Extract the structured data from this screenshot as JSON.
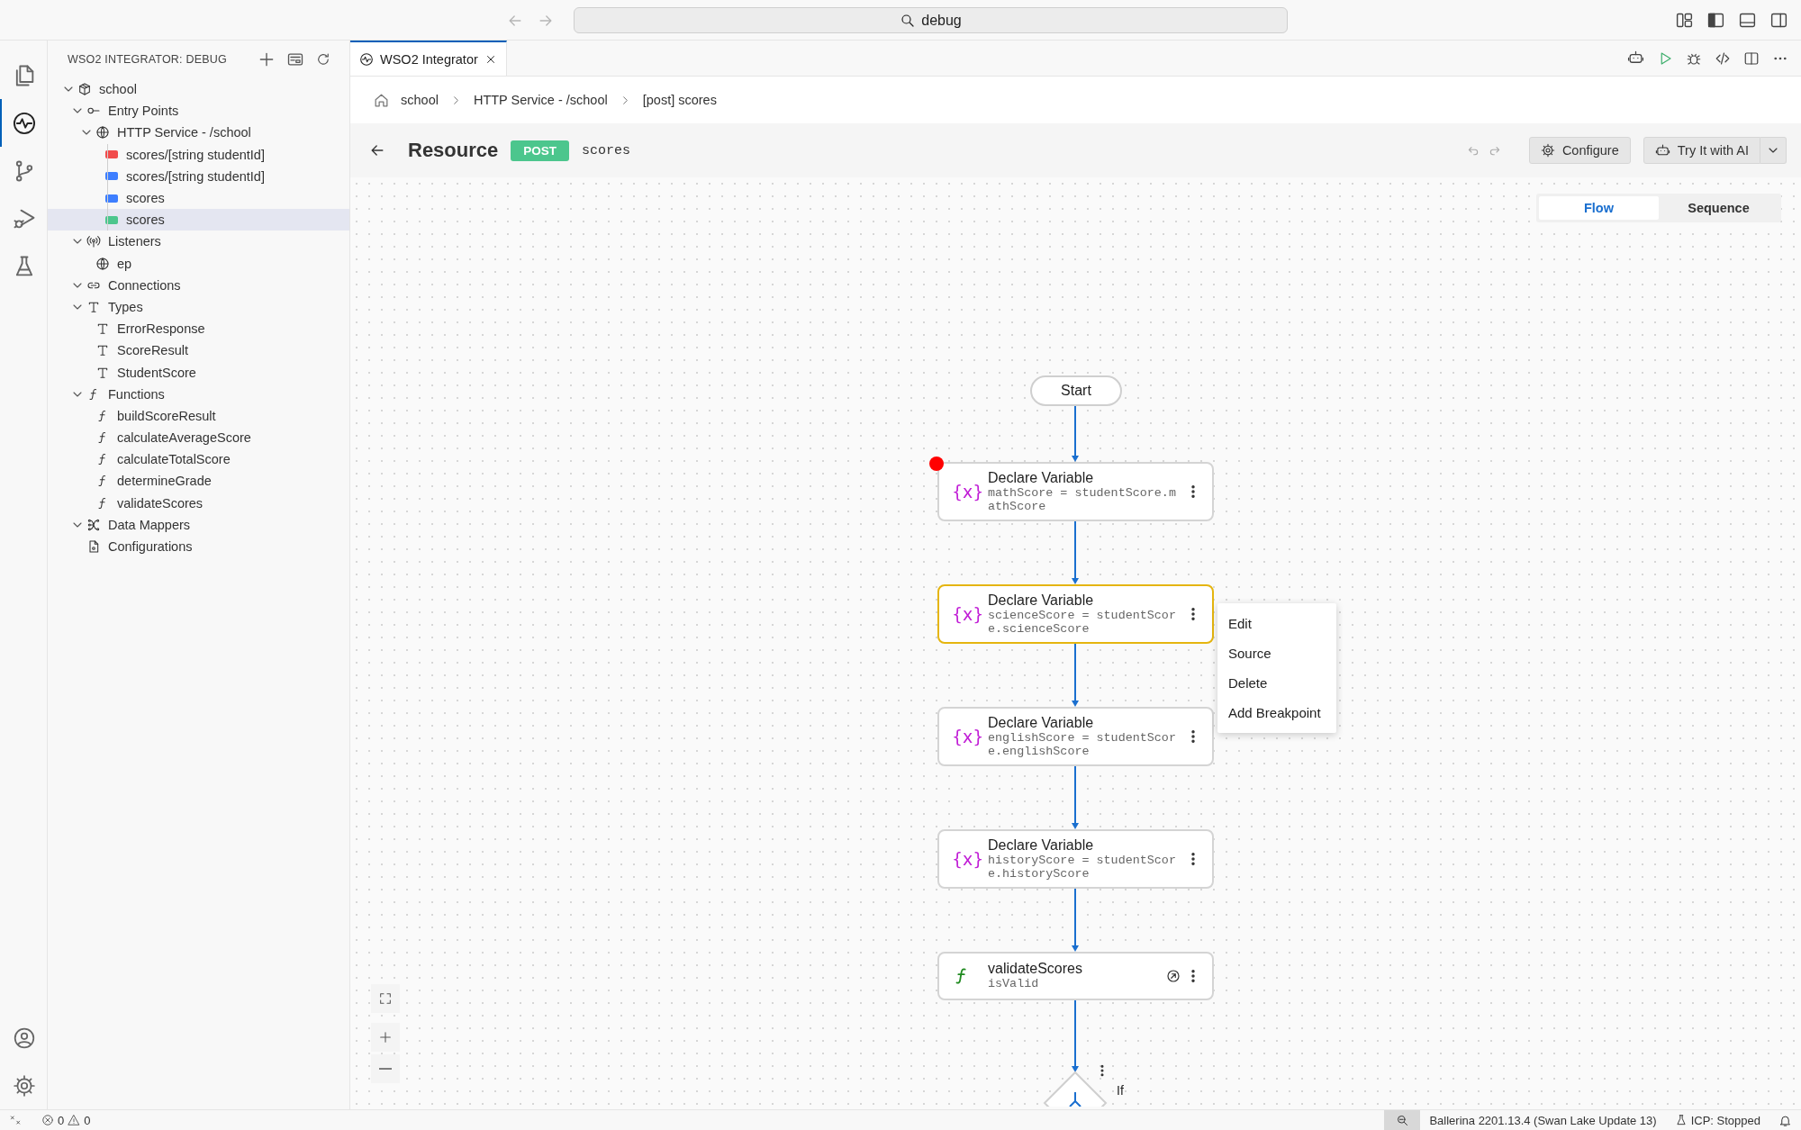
{
  "title_bar": {
    "search": "debug"
  },
  "activity_bar": {
    "items": [
      {
        "kind": "explorer",
        "selected": false
      },
      {
        "kind": "integrator",
        "selected": true
      },
      {
        "kind": "source-control",
        "selected": false
      },
      {
        "kind": "run-debug",
        "selected": false
      },
      {
        "kind": "testing",
        "selected": false
      }
    ]
  },
  "sidebar": {
    "title": "WSO2 INTEGRATOR: DEBUG",
    "tree": [
      {
        "label": "school",
        "kind": "package",
        "expanded": true,
        "selected": false,
        "children": [
          {
            "label": "Entry Points",
            "kind": "entry",
            "expanded": true,
            "selected": false,
            "children": [
              {
                "label": "HTTP Service - /school",
                "kind": "globe",
                "expanded": true,
                "selected": false,
                "children": [
                  {
                    "label": "scores/[string studentId]",
                    "kind": "resource",
                    "color": "#f14c4c",
                    "selected": false
                  },
                  {
                    "label": "scores/[string studentId]",
                    "kind": "resource",
                    "color": "#3d7eff",
                    "selected": false
                  },
                  {
                    "label": "scores",
                    "kind": "resource",
                    "color": "#3d7eff",
                    "selected": false
                  },
                  {
                    "label": "scores",
                    "kind": "resource",
                    "color": "#4cc68d",
                    "selected": true
                  }
                ]
              }
            ]
          },
          {
            "label": "Listeners",
            "kind": "listener",
            "expanded": true,
            "selected": false,
            "children": [
              {
                "label": "ep",
                "kind": "globe",
                "selected": false
              }
            ]
          },
          {
            "label": "Connections",
            "kind": "connection",
            "expanded": true,
            "selected": false
          },
          {
            "label": "Types",
            "kind": "type",
            "expanded": true,
            "selected": false,
            "children": [
              {
                "label": "ErrorResponse",
                "kind": "type",
                "selected": false
              },
              {
                "label": "ScoreResult",
                "kind": "type",
                "selected": false
              },
              {
                "label": "StudentScore",
                "kind": "type",
                "selected": false
              }
            ]
          },
          {
            "label": "Functions",
            "kind": "function",
            "expanded": true,
            "selected": false,
            "children": [
              {
                "label": "buildScoreResult",
                "kind": "function",
                "selected": false
              },
              {
                "label": "calculateAverageScore",
                "kind": "function",
                "selected": false
              },
              {
                "label": "calculateTotalScore",
                "kind": "function",
                "selected": false
              },
              {
                "label": "determineGrade",
                "kind": "function",
                "selected": false
              },
              {
                "label": "validateScores",
                "kind": "function",
                "selected": false
              }
            ]
          },
          {
            "label": "Data Mappers",
            "kind": "mapper",
            "expanded": true,
            "selected": false
          },
          {
            "label": "Configurations",
            "kind": "config",
            "selected": false
          }
        ]
      }
    ]
  },
  "editor": {
    "tabs": [
      {
        "label": "WSO2 Integrator",
        "selected": true
      }
    ],
    "breadcrumb": [
      "school",
      "HTTP Service - /school",
      "[post] scores"
    ],
    "header": {
      "title": "Resource",
      "method": "POST",
      "path": "scores",
      "configure": "Configure",
      "try_ai": "Try It with AI"
    },
    "view_toggle": [
      {
        "label": "Flow",
        "selected": true
      },
      {
        "label": "Sequence",
        "selected": false
      }
    ],
    "flow": [
      {
        "kind": "start",
        "label": "Start"
      },
      {
        "kind": "variable",
        "icon": "{x}",
        "title": "Declare Variable",
        "detail": "mathScore = studentScore.mathScore",
        "breakpoint": true,
        "highlighted": false
      },
      {
        "kind": "variable",
        "icon": "{x}",
        "title": "Declare Variable",
        "detail": "scienceScore = studentScore.scienceScore",
        "breakpoint": false,
        "highlighted": true
      },
      {
        "kind": "variable",
        "icon": "{x}",
        "title": "Declare Variable",
        "detail": "englishScore = studentScore.englishScore",
        "breakpoint": false,
        "highlighted": false
      },
      {
        "kind": "variable",
        "icon": "{x}",
        "title": "Declare Variable",
        "detail": "historyScore = studentScore.historyScore",
        "breakpoint": false,
        "highlighted": false
      },
      {
        "kind": "function",
        "title": "validateScores",
        "detail": "isValid",
        "breakpoint": false,
        "highlighted": false
      },
      {
        "kind": "if",
        "label": "If"
      }
    ],
    "context_menu": [
      "Edit",
      "Source",
      "Delete",
      "Add Breakpoint"
    ]
  },
  "status_bar": {
    "errors": "0",
    "warnings": "0",
    "version": "Ballerina 2201.13.4 (Swan Lake Update 13)",
    "icp": "ICP: Stopped"
  }
}
